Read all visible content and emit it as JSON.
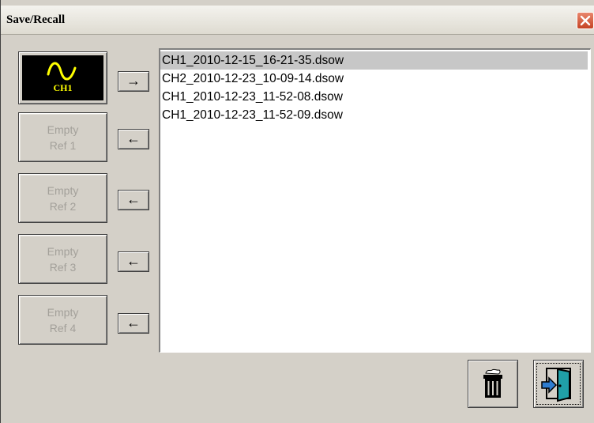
{
  "window": {
    "title": "Save/Recall",
    "close_icon": "close-icon"
  },
  "channel": {
    "label": "CH1",
    "icon": "sine-wave-icon",
    "label_color": "#ffff00",
    "send_arrow": "→"
  },
  "refs": [
    {
      "line1": "Empty",
      "line2": "Ref 1",
      "arrow": "←"
    },
    {
      "line1": "Empty",
      "line2": "Ref 2",
      "arrow": "←"
    },
    {
      "line1": "Empty",
      "line2": "Ref 3",
      "arrow": "←"
    },
    {
      "line1": "Empty",
      "line2": "Ref 4",
      "arrow": "←"
    }
  ],
  "files": [
    {
      "name": "CH1_2010-12-15_16-21-35.dsow",
      "selected": true
    },
    {
      "name": "CH2_2010-12-23_10-09-14.dsow",
      "selected": false
    },
    {
      "name": "CH1_2010-12-23_11-52-08.dsow",
      "selected": false
    },
    {
      "name": "CH1_2010-12-23_11-52-09.dsow",
      "selected": false
    }
  ],
  "actions": {
    "delete_icon": "trash-can-icon",
    "exit_icon": "exit-door-icon"
  },
  "colors": {
    "dialog_bg": "#d4d0c8",
    "selection": "#c7c7c7",
    "close_button": "#c54324"
  }
}
